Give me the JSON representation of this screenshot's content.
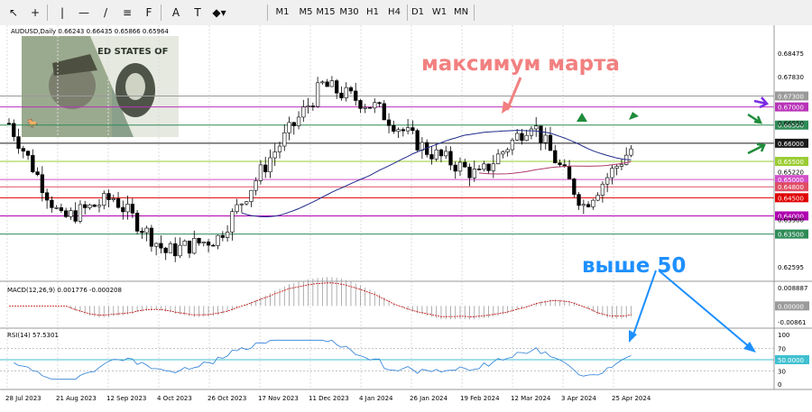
{
  "toolbar": {
    "tools": [
      {
        "name": "cursor-tool",
        "label": "↖"
      },
      {
        "name": "crosshair-tool",
        "label": "+"
      },
      {
        "name": "vertical-line-tool",
        "label": "|"
      },
      {
        "name": "horizontal-line-tool",
        "label": "—"
      },
      {
        "name": "trendline-tool",
        "label": "/"
      },
      {
        "name": "channel-tool",
        "label": "≡"
      },
      {
        "name": "fibonacci-tool",
        "label": "F"
      },
      {
        "name": "text-tool",
        "label": "A"
      },
      {
        "name": "label-tool",
        "label": "T"
      },
      {
        "name": "shapes-tool",
        "label": "◆▾"
      }
    ],
    "timeframes": [
      "M1",
      "M5",
      "M15",
      "M30",
      "H1",
      "H4",
      "D1",
      "W1",
      "MN"
    ]
  },
  "main": {
    "header": "AUDUSD,Daily  0.66243 0.66435 0.65866 0.65964",
    "annotation_march": "максимум марта",
    "annotation_above50": "выше 50",
    "price_axis": [
      {
        "label": "0.68475",
        "price": 0.68475
      },
      {
        "label": "0.67830",
        "price": 0.6783
      },
      {
        "label": "0.66550",
        "price": 0.6655
      },
      {
        "label": "0.65220",
        "price": 0.6522
      },
      {
        "label": "0.63900",
        "price": 0.639
      },
      {
        "label": "0.62595",
        "price": 0.62595
      }
    ],
    "levels": [
      {
        "label": "0.67300",
        "price": 0.673,
        "color": "#9a9a9a",
        "text": "#ffffff"
      },
      {
        "label": "0.67000",
        "price": 0.67,
        "color": "#b833b8",
        "text": "#ffffff"
      },
      {
        "label": "0.66500",
        "price": 0.665,
        "color": "#2e8b57",
        "text": "#ffffff"
      },
      {
        "label": "0.66000",
        "price": 0.66,
        "color": "#1a1a1a",
        "text": "#ffffff"
      },
      {
        "label": "0.65500",
        "price": 0.655,
        "color": "#9acd32",
        "text": "#ffffff"
      },
      {
        "label": "0.65000",
        "price": 0.65,
        "color": "#d24fc8",
        "text": "#ffffff"
      },
      {
        "label": "0.64800",
        "price": 0.648,
        "color": "#e04d63",
        "text": "#ffffff"
      },
      {
        "label": "0.64500",
        "price": 0.645,
        "color": "#e00000",
        "text": "#ffffff"
      },
      {
        "label": "0.64000",
        "price": 0.64,
        "color": "#b000b0",
        "text": "#ffffff"
      },
      {
        "label": "0.63500",
        "price": 0.635,
        "color": "#2e8b57",
        "text": "#ffffff"
      }
    ],
    "dates": [
      "28 Jul 2023",
      "21 Aug 2023",
      "12 Sep 2023",
      "4 Oct 2023",
      "26 Oct 2023",
      "17 Nov 2023",
      "11 Dec 2023",
      "4 Jan 2024",
      "26 Jan 2024",
      "19 Feb 2024",
      "12 Mar 2024",
      "3 Apr 2024",
      "25 Apr 2024"
    ]
  },
  "macd": {
    "header": "MACD(12,26,9) 0.001776 -0.000208",
    "axis": [
      {
        "label": "0.008887",
        "value": 0.008887
      },
      {
        "label": "0.00000",
        "value": 0
      },
      {
        "label": "-0.00861",
        "value": -0.00861
      }
    ]
  },
  "rsi": {
    "header": "RSI(14) 57.5301",
    "axis": [
      {
        "label": "100",
        "value": 100
      },
      {
        "label": "70",
        "value": 70
      },
      {
        "label": "50.0000",
        "value": 50
      },
      {
        "label": "30",
        "value": 30
      },
      {
        "label": "0",
        "value": 0
      }
    ]
  },
  "chart_data": {
    "type": "candlestick",
    "title": "AUDUSD,Daily",
    "ohlc_last": {
      "open": 0.66243,
      "high": 0.66435,
      "low": 0.65866,
      "close": 0.65964
    },
    "ylim": [
      0.6225,
      0.6895
    ],
    "x": [
      "28 Jul 2023",
      "21 Aug 2023",
      "12 Sep 2023",
      "4 Oct 2023",
      "26 Oct 2023",
      "17 Nov 2023",
      "11 Dec 2023",
      "4 Jan 2024",
      "26 Jan 2024",
      "19 Feb 2024",
      "12 Mar 2024",
      "3 Apr 2024",
      "25 Apr 2024"
    ],
    "close_approx": [
      0.6655,
      0.639,
      0.645,
      0.63,
      0.634,
      0.656,
      0.676,
      0.67,
      0.658,
      0.651,
      0.666,
      0.643,
      0.66
    ],
    "macd": {
      "params": "12,26,9",
      "main": 0.001776,
      "signal": -0.000208,
      "ylim": [
        -0.00861,
        0.008887
      ]
    },
    "rsi": {
      "period": 14,
      "value": 57.5301,
      "levels": [
        70,
        50,
        30
      ],
      "ylim": [
        0,
        100
      ]
    }
  }
}
